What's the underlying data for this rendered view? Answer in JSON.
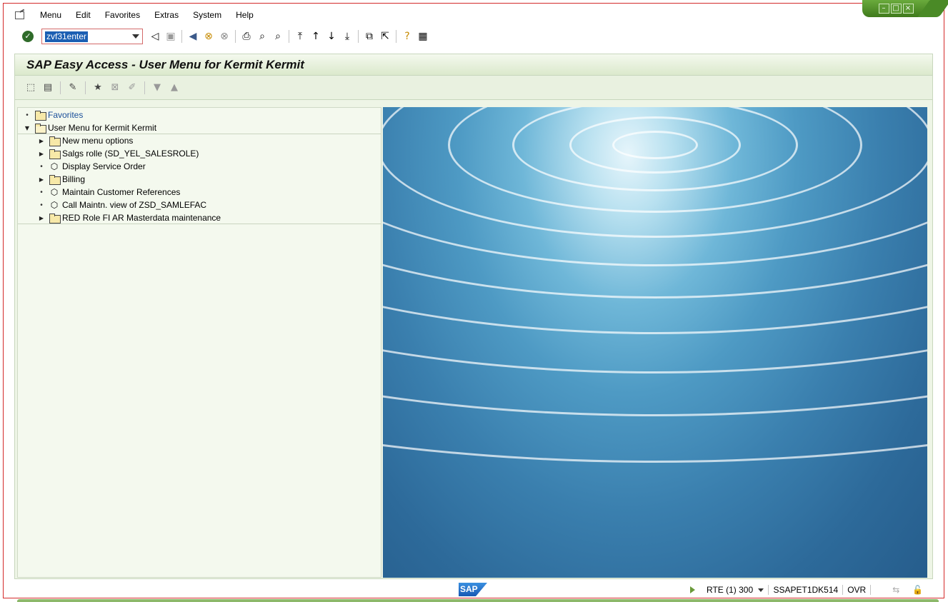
{
  "window": {
    "controls": [
      "minimize",
      "maximize",
      "close"
    ]
  },
  "menubar": {
    "items": [
      "Menu",
      "Edit",
      "Favorites",
      "Extras",
      "System",
      "Help"
    ]
  },
  "toolbar": {
    "command_value": "zvf31enter"
  },
  "screen": {
    "title": "SAP Easy Access  -  User Menu for Kermit Kermit"
  },
  "tree": {
    "favorites": "Favorites",
    "root": "User Menu for Kermit Kermit",
    "items": [
      {
        "label": "New menu options",
        "type": "folder"
      },
      {
        "label": "Salgs rolle (SD_YEL_SALESROLE)",
        "type": "folder"
      },
      {
        "label": "Display Service Order",
        "type": "transaction"
      },
      {
        "label": "Billing",
        "type": "folder"
      },
      {
        "label": "Maintain Customer References",
        "type": "transaction"
      },
      {
        "label": "Call Maintn. view of ZSD_SAMLEFAC",
        "type": "transaction"
      },
      {
        "label": "RED Role FI AR Masterdata maintenance",
        "type": "folder"
      }
    ]
  },
  "status": {
    "logo": "SAP",
    "system": "RTE (1) 300",
    "server": "SSAPET1DK514",
    "mode": "OVR"
  },
  "colors": {
    "panel_bg": "#eef5e6",
    "frame": "#d42a2a",
    "selection": "#1b5fb3",
    "window_controls": "#4a8a26"
  }
}
